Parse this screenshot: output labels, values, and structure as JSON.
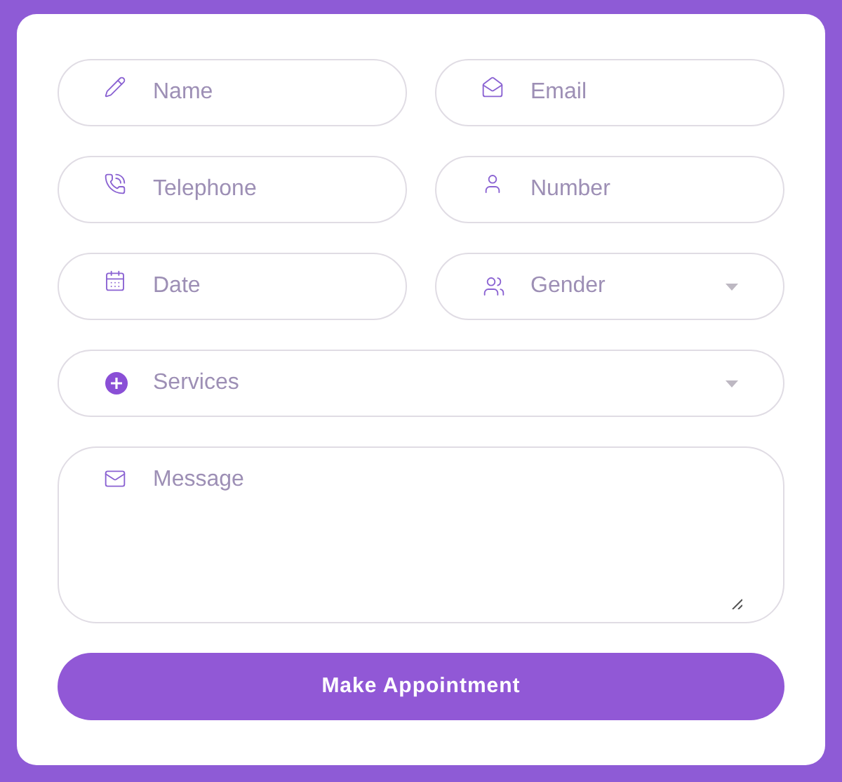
{
  "form": {
    "fields": [
      {
        "kind": "input",
        "placeholder": "Name"
      },
      {
        "kind": "input",
        "placeholder": "Email"
      },
      {
        "kind": "input",
        "placeholder": "Telephone"
      },
      {
        "kind": "input",
        "placeholder": "Number"
      },
      {
        "kind": "input",
        "placeholder": "Date"
      },
      {
        "kind": "select",
        "placeholder": "Gender"
      },
      {
        "kind": "select",
        "placeholder": "Services",
        "wide": true
      },
      {
        "kind": "textarea",
        "placeholder": "Message",
        "wide": true
      }
    ],
    "submit": "Make Appointment"
  }
}
